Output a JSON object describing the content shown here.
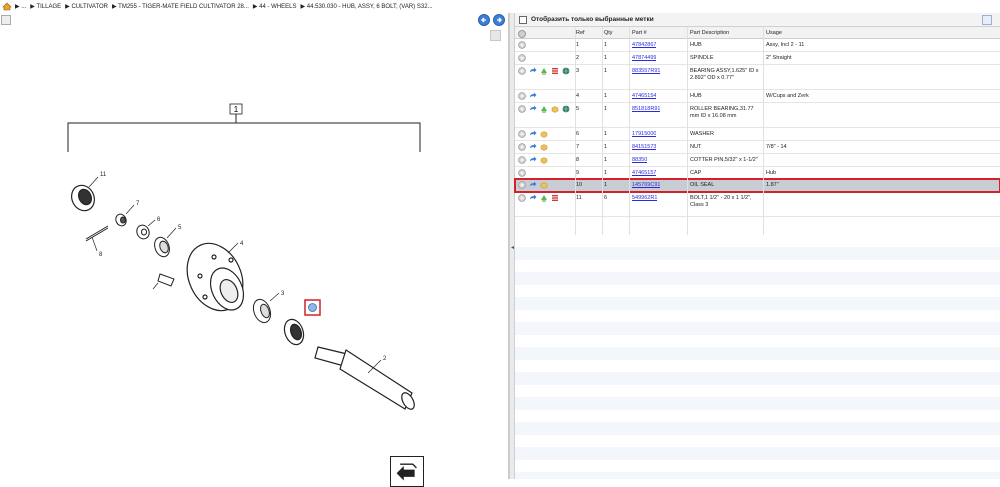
{
  "breadcrumb": {
    "items": [
      "▶ ...",
      "▶ TILLAGE",
      "▶ CULTIVATOR",
      "▶ TM255 - TIGER-MATE FIELD CULTIVATOR 28...",
      "▶ 44 - WHEELS",
      "▶ 44.530.030 - HUB, ASSY, 6 BOLT; (VAR) S32..."
    ]
  },
  "filter": {
    "label": "Отобразить только выбранные метки"
  },
  "table": {
    "headers": {
      "ref": "Ref",
      "qty": "Qty",
      "part": "Part #",
      "desc": "Part Description",
      "usage": "Usage"
    },
    "rows": [
      {
        "ref": "1",
        "qty": "1",
        "part": "47842867",
        "desc": "HUB",
        "usage": "Assy, Incl 2 - 11"
      },
      {
        "ref": "2",
        "qty": "1",
        "part": "47874499",
        "desc": "SPINDLE",
        "usage": "2\" Straight"
      },
      {
        "ref": "3",
        "qty": "1",
        "part": "883557R91",
        "desc": "BEARING ASSY,1.625\" ID x 2.892\" OD x 0.77\"",
        "usage": ""
      },
      {
        "ref": "4",
        "qty": "1",
        "part": "47465154",
        "desc": "HUB",
        "usage": "W/Cups and Zerk"
      },
      {
        "ref": "5",
        "qty": "1",
        "part": "851818R91",
        "desc": "ROLLER BEARING,31.77 mm ID x 16.08 mm",
        "usage": ""
      },
      {
        "ref": "6",
        "qty": "1",
        "part": "17915000",
        "desc": "WASHER",
        "usage": ""
      },
      {
        "ref": "7",
        "qty": "1",
        "part": "84151573",
        "desc": "NUT",
        "usage": "7/8\" - 14"
      },
      {
        "ref": "8",
        "qty": "1",
        "part": "88350",
        "desc": "COTTER PIN,5/32\" x 1-1/2\"",
        "usage": ""
      },
      {
        "ref": "9",
        "qty": "1",
        "part": "47465157",
        "desc": "CAP",
        "usage": "Hub"
      },
      {
        "ref": "10",
        "qty": "1",
        "part": "145769C91",
        "desc": "OIL SEAL",
        "usage": "1.87\""
      },
      {
        "ref": "11",
        "qty": "6",
        "part": "549962R1",
        "desc": "BOLT,1 1/2\" - 20 x 1 1/2\", Class 3",
        "usage": ""
      }
    ]
  },
  "diagram": {
    "callouts": [
      "1",
      "2",
      "3",
      "4",
      "5",
      "6",
      "7",
      "8",
      "9",
      "11"
    ]
  },
  "colors": {
    "accent": "#3b80d6",
    "selection_outline": "#d3202a",
    "link": "#2a2ae0"
  }
}
